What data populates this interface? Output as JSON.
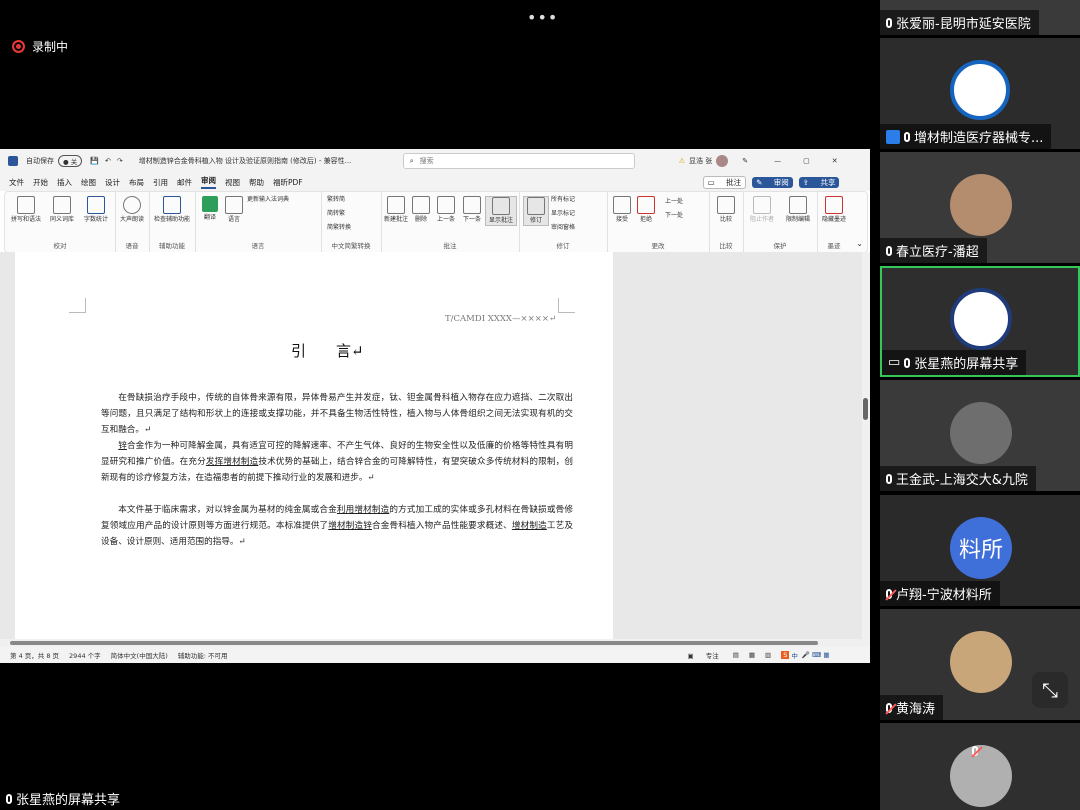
{
  "meeting": {
    "recording_label": "录制中",
    "more_label": "•••",
    "bottom_share_label": "张星燕的屏幕共享"
  },
  "word": {
    "autosave_label": "自动保存",
    "autosave_state": "关",
    "doc_title": "增材制造锌合金骨科植入物 设计及验证原则指南 (修改后) - 兼容性...",
    "search_placeholder": "搜索",
    "user_label": "显浩 张",
    "menu": [
      "文件",
      "开始",
      "插入",
      "绘图",
      "设计",
      "布局",
      "引用",
      "邮件",
      "审阅",
      "视图",
      "帮助",
      "福昕PDF"
    ],
    "active_menu": "审阅",
    "comment_btn": "批注",
    "review_btn": "审阅",
    "share_btn": "共享",
    "ribbon_groups": [
      {
        "name": "校对",
        "buttons": [
          "拼写和语法",
          "同义词库",
          "字数统计"
        ]
      },
      {
        "name": "语音",
        "buttons": [
          "大声朗读"
        ]
      },
      {
        "name": "辅助功能",
        "buttons": [
          "检查辅助功能"
        ]
      },
      {
        "name": "语言",
        "buttons": [
          "翻译",
          "语言",
          "更新输入法词典"
        ]
      },
      {
        "name": "中文简繁转换",
        "buttons": [
          "繁转简",
          "简转繁",
          "简繁转换"
        ]
      },
      {
        "name": "批注",
        "buttons": [
          "新建批注",
          "删除",
          "上一条",
          "下一条",
          "显示批注"
        ]
      },
      {
        "name": "修订",
        "buttons": [
          "修订",
          "所有标记",
          "显示标记",
          "审阅窗格"
        ]
      },
      {
        "name": "更改",
        "buttons": [
          "接受",
          "拒绝",
          "上一处",
          "下一处"
        ]
      },
      {
        "name": "比较",
        "buttons": [
          "比较"
        ]
      },
      {
        "name": "保护",
        "buttons": [
          "阻止作者",
          "限制编辑"
        ]
      },
      {
        "name": "墨迹",
        "buttons": [
          "隐藏墨迹"
        ]
      }
    ],
    "header_ref": "T/CAMDI XXXX—××××↵",
    "heading": "引　　言↵",
    "para1": "在骨缺损治疗手段中，传统的自体骨来源有限，异体骨易产生并发症，钛、钽金属骨科植入物存在应力遮挡、二次取出等问题，且只满足了结构和形状上的连接或支撑功能，并不具备生物活性特性，植入物与人体骨组织之间无法实现有机的交互和融合。↵",
    "para2_a": "锌",
    "para2_b": "合金作为一种可降解金属，具有适宜可控的降解速率、不产生气体、良好的生物安全性以及低廉的价格等特性具有明显研究和推广价值。在充分",
    "para2_link": "发挥增材制造",
    "para2_c": "技术优势的基础上，结合锌合金的可降解特性，有望突破众多传统材料的限制，创新现有的诊疗修复方法，在造福患者的前提下推动行业的发展和进步。↵",
    "para3_a": "本文件基于临床需求，对以锌金属为基材的纯金属或合金",
    "para3_link1": "利用增材制造",
    "para3_b": "的方式加工成的实体或多孔材料在骨缺损或骨修复领域应用产品的设计原则等方面进行规范。本标准提供了",
    "para3_link2": "增材制造锌",
    "para3_c": "合金骨科植入物产品性能要求概述、",
    "para3_link3": "增材制造",
    "para3_d": "工艺及设备、设计原则、适用范围的指导。↵",
    "status": {
      "page": "第 4 页，共 8 页",
      "words": "2944 个字",
      "lang": "简体中文(中国大陆)",
      "accessibility": "辅助功能: 不可用",
      "focus": "专注"
    }
  },
  "participants": [
    {
      "name": "张爱丽-昆明市延安医院",
      "muted": false
    },
    {
      "name": "增材制造医疗器械专...",
      "muted": false
    },
    {
      "name": "春立医疗-潘超",
      "muted": false
    },
    {
      "name": "张星燕的屏幕共享",
      "muted": false,
      "active": true
    },
    {
      "name": "王金武-上海交大&九院",
      "muted": false
    },
    {
      "name": "卢翔-宁波材料所",
      "muted": true,
      "initials": "料所"
    },
    {
      "name": "黄海涛",
      "muted": true
    },
    {
      "name": "",
      "muted": true
    }
  ],
  "colors": {
    "accent": "#2b579a",
    "active_border": "#34c759",
    "record": "#e53935",
    "initials_bg": "#3f6fd8"
  }
}
